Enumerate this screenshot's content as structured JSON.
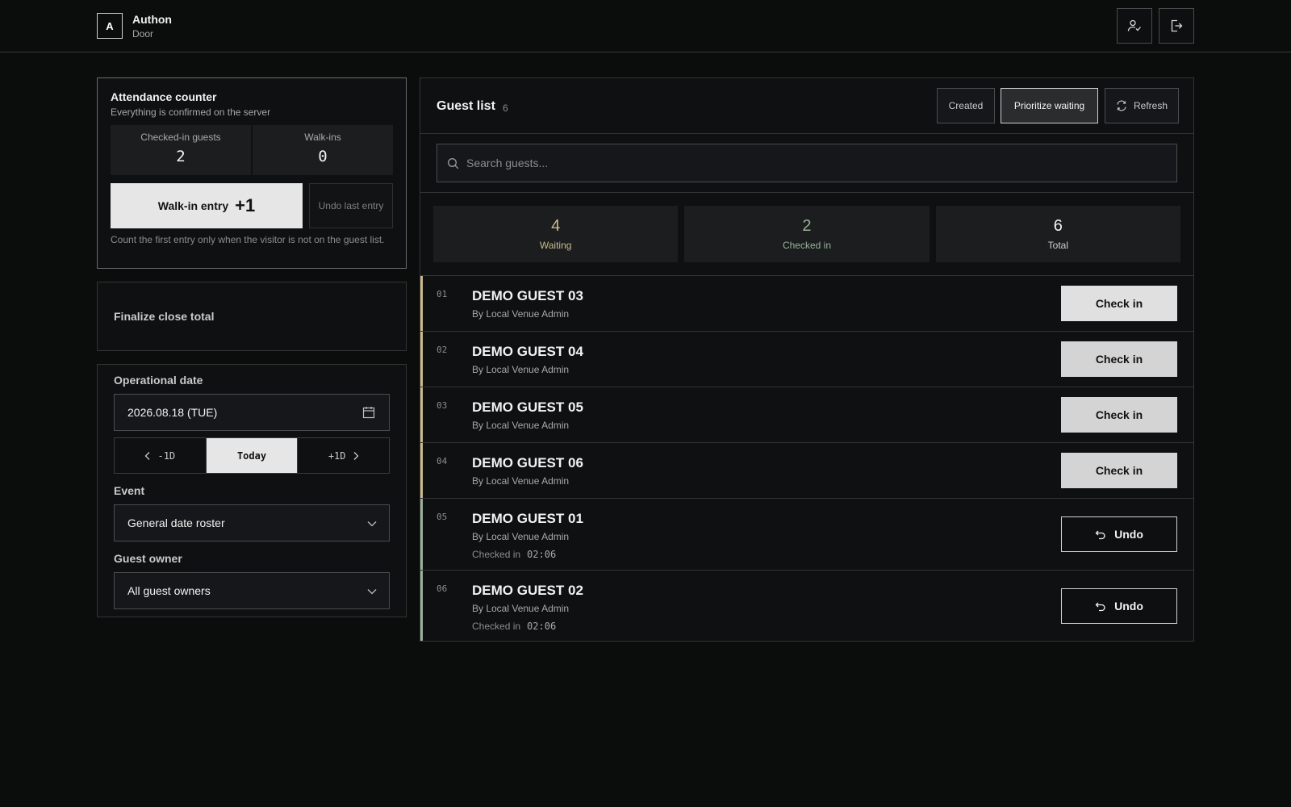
{
  "header": {
    "logo_letter": "A",
    "app_name": "Authon",
    "app_subtitle": "Door",
    "buttons": [
      {
        "name": "user-check-icon"
      },
      {
        "name": "logout-icon"
      }
    ]
  },
  "attendance": {
    "title": "Attendance counter",
    "subtitle": "Everything is confirmed on the server",
    "checked_in_label": "Checked-in guests",
    "checked_in_value": "2",
    "walkins_label": "Walk-ins",
    "walkins_value": "0",
    "walkin_button_label": "Walk-in entry",
    "walkin_button_increment": "+1",
    "undo_last_label": "Undo last entry",
    "note": "Count the first entry only when the visitor is not on the guest list."
  },
  "finalize": {
    "label": "Finalize close total"
  },
  "filters": {
    "date_label": "Operational date",
    "date_value": "2026.08.18 (TUE)",
    "prev_day": "-1D",
    "today": "Today",
    "next_day": "+1D",
    "event_label": "Event",
    "event_value": "General date roster",
    "owner_label": "Guest owner",
    "owner_value": "All guest owners"
  },
  "guest_list": {
    "title": "Guest list",
    "count": "6",
    "sort_created": "Created",
    "sort_waiting": "Prioritize waiting",
    "refresh": "Refresh",
    "search_placeholder": "Search guests...",
    "summary": {
      "waiting_value": "4",
      "waiting_label": "Waiting",
      "checked_value": "2",
      "checked_label": "Checked in",
      "total_value": "6",
      "total_label": "Total"
    },
    "check_in_label": "Check in",
    "undo_label": "Undo",
    "checked_in_prefix": "Checked in",
    "rows": [
      {
        "num": "01",
        "name": "DEMO GUEST 03",
        "by": "By Local Venue Admin",
        "status": "waiting"
      },
      {
        "num": "02",
        "name": "DEMO GUEST 04",
        "by": "By Local Venue Admin",
        "status": "waiting"
      },
      {
        "num": "03",
        "name": "DEMO GUEST 05",
        "by": "By Local Venue Admin",
        "status": "waiting"
      },
      {
        "num": "04",
        "name": "DEMO GUEST 06",
        "by": "By Local Venue Admin",
        "status": "waiting"
      },
      {
        "num": "05",
        "name": "DEMO GUEST 01",
        "by": "By Local Venue Admin",
        "status": "checked",
        "time": "02:06"
      },
      {
        "num": "06",
        "name": "DEMO GUEST 02",
        "by": "By Local Venue Admin",
        "status": "checked",
        "time": "02:06"
      }
    ]
  },
  "colors": {
    "waiting_accent": "#cdb98c",
    "checked_accent": "#9cb09a",
    "total_text": "#f2f2f2"
  }
}
